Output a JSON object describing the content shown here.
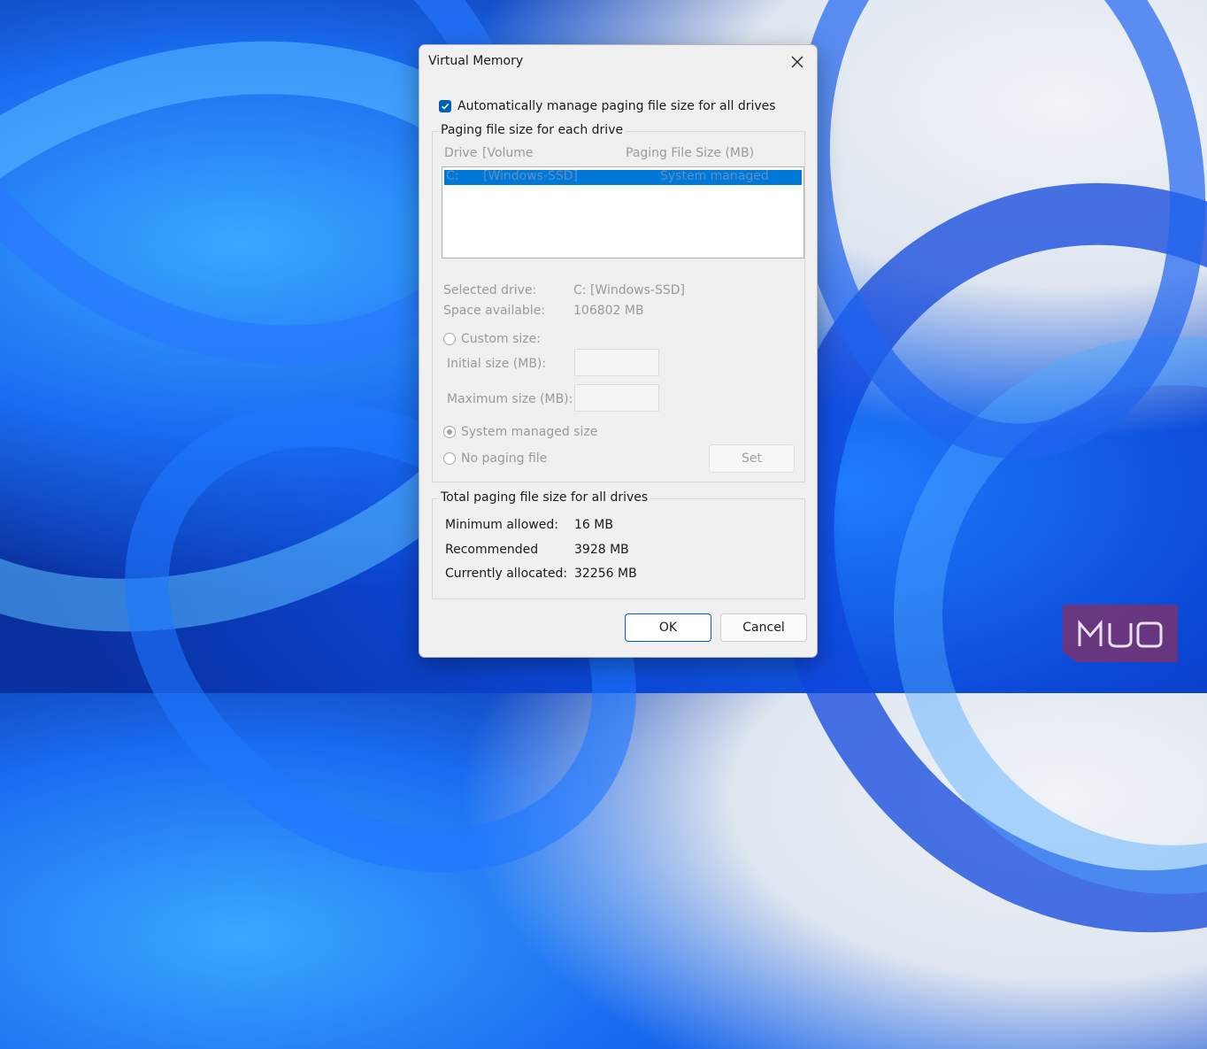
{
  "dialog": {
    "title": "Virtual Memory",
    "auto_manage_label": "Automatically manage paging file size for all drives",
    "auto_manage_checked": true
  },
  "per_drive": {
    "group_label": "Paging file size for each drive",
    "col_drive": "Drive",
    "col_volume": "[Volume",
    "col_size": "Paging File Size (MB)",
    "rows": [
      {
        "drive": "C:",
        "volume": "[Windows-SSD]",
        "size": "System managed"
      }
    ],
    "selected_drive_label": "Selected drive:",
    "selected_drive_value": "C:  [Windows-SSD]",
    "space_label": "Space available:",
    "space_value": "106802 MB",
    "custom_size_label": "Custom size:",
    "initial_label": "Initial size (MB):",
    "maximum_label": "Maximum size (MB):",
    "system_managed_label": "System managed size",
    "no_paging_label": "No paging file",
    "set_label": "Set"
  },
  "totals": {
    "group_label": "Total paging file size for all drives",
    "min_label": "Minimum allowed:",
    "min_value": "16 MB",
    "rec_label": "Recommended",
    "rec_value": "3928 MB",
    "cur_label": "Currently allocated:",
    "cur_value": "32256 MB"
  },
  "buttons": {
    "ok": "OK",
    "cancel": "Cancel"
  },
  "watermark": {
    "text": "MUO"
  },
  "colors": {
    "accent": "#005fb8",
    "selection": "#0078d7"
  }
}
